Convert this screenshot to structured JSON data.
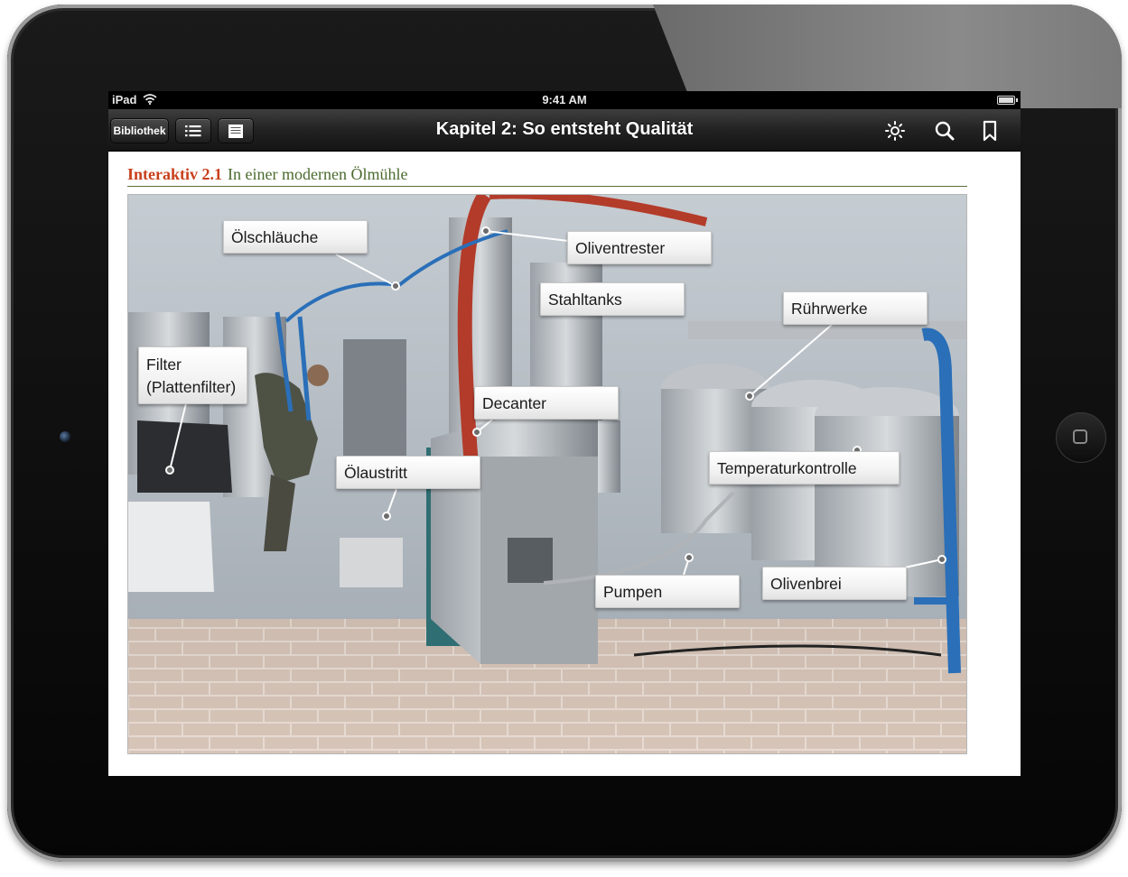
{
  "status_bar": {
    "device": "iPad",
    "time": "9:41 AM"
  },
  "toolbar": {
    "library_button": "Bibliothek",
    "title": "Kapitel 2: So entsteht Qualität",
    "icons": [
      "list-icon",
      "page-icon",
      "brightness-icon",
      "search-icon",
      "bookmark-icon"
    ]
  },
  "figure": {
    "number": "Interaktiv 2.1",
    "caption": "In einer modernen Ölmühle",
    "labels": {
      "oelschlaeuche": "Ölschläuche",
      "oliventrester": "Oliventrester",
      "stahltanks": "Stahltanks",
      "ruehrwerke": "Rührwerke",
      "filter_line1": "Filter",
      "filter_line2": "(Plattenfilter)",
      "decanter": "Decanter",
      "oelaustritt": "Ölaustritt",
      "temperaturkontrolle": "Temperaturkontrolle",
      "pumpen": "Pumpen",
      "olivenbrei": "Olivenbrei"
    }
  },
  "colors": {
    "caption_number": "#c8401c",
    "caption_text": "#4a6a2e",
    "toolbar": "#222222"
  }
}
